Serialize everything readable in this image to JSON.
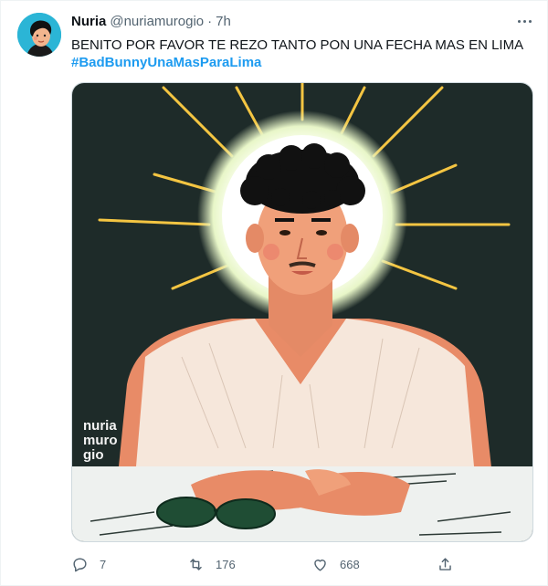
{
  "tweet": {
    "author_name": "Nuria",
    "author_handle": "@nuriamurogio",
    "separator": "·",
    "time": "7h",
    "text": "BENITO POR FAVOR TE REZO TANTO PON UNA FECHA MAS EN LIMA",
    "hashtag": "#BadBunnyUnaMasParaLima",
    "image_signature": "nuria muro gio"
  },
  "actions": {
    "reply_count": "7",
    "retweet_count": "176",
    "like_count": "668"
  },
  "icons": {
    "reply": "reply-icon",
    "retweet": "retweet-icon",
    "like": "heart-icon",
    "share": "share-icon",
    "more": "more-dots-icon"
  },
  "colors": {
    "link": "#1d9bf0",
    "secondary_text": "#536471",
    "primary_text": "#0f1419"
  }
}
